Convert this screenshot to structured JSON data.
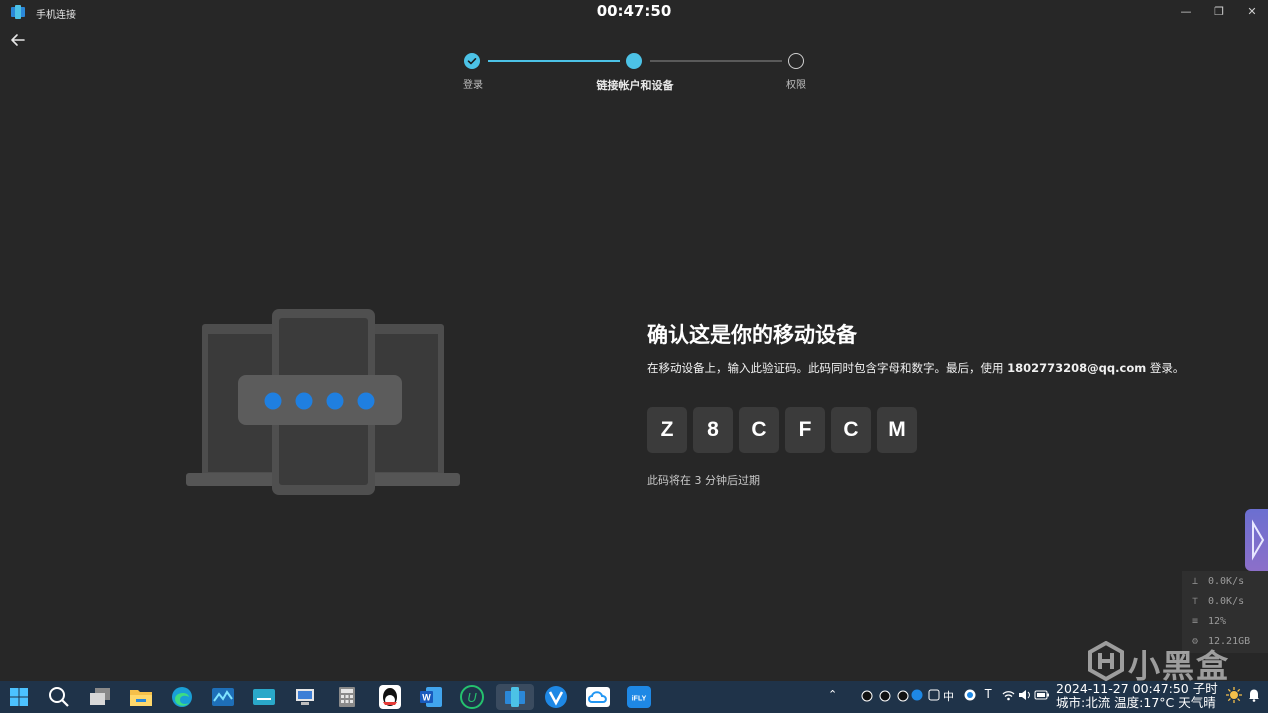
{
  "window": {
    "title": "手机连接",
    "clock": "00:47:50"
  },
  "stepper": {
    "steps": [
      {
        "label": "登录",
        "state": "done"
      },
      {
        "label": "链接帐户和设备",
        "state": "current"
      },
      {
        "label": "权限",
        "state": "pending"
      }
    ]
  },
  "main": {
    "heading": "确认这是你的移动设备",
    "desc_prefix": "在移动设备上，输入此验证码。此码同时包含字母和数字。最后，使用 ",
    "email": "1802773208@qq.com",
    "desc_suffix": " 登录。",
    "code": [
      "Z",
      "8",
      "C",
      "F",
      "C",
      "M"
    ],
    "expire_text": "此码将在 3 分钟后过期"
  },
  "netmon": {
    "download": "0.0K/s",
    "upload": "0.0K/s",
    "cpu": "12%",
    "memory": "12.21GB"
  },
  "watermark": {
    "text": "小黑盒"
  },
  "taskbar": {
    "ime": "中",
    "datetime_line1": "2024-11-27 00:47:50 子时",
    "datetime_line2": "城市:北流 温度:17°C 天气晴"
  },
  "colors": {
    "accent": "#4cc2e6",
    "background": "#272727",
    "taskbar": "#1f3349"
  }
}
